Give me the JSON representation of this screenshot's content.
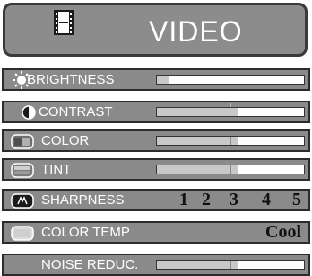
{
  "header": {
    "title": "VIDEO",
    "icon": "film-icon"
  },
  "menu": [
    {
      "id": "brightness",
      "label": "BRIGHTNESS",
      "icon": "sun-icon",
      "level": 0.08,
      "center_mark": false
    },
    {
      "id": "contrast",
      "label": "CONTRAST",
      "icon": "contrast-icon",
      "level": 0.55,
      "center_mark": true
    },
    {
      "id": "color",
      "label": "COLOR",
      "icon": "color-icon",
      "level": 0.55,
      "center_mark": true
    },
    {
      "id": "tint",
      "label": "TINT",
      "icon": "tint-icon",
      "level": 0.55,
      "center_mark": true
    },
    {
      "id": "sharpness",
      "label": "SHARPNESS",
      "icon": "sharpness-icon",
      "scale": [
        "1",
        "2",
        "3",
        "4",
        "5"
      ]
    },
    {
      "id": "color-temp",
      "label": "COLOR TEMP",
      "icon": "color-temp-icon",
      "value": "Cool"
    },
    {
      "id": "noise-reduc",
      "label": "NOISE REDUC.",
      "icon": "",
      "level": 0.55,
      "center_mark": true
    }
  ]
}
